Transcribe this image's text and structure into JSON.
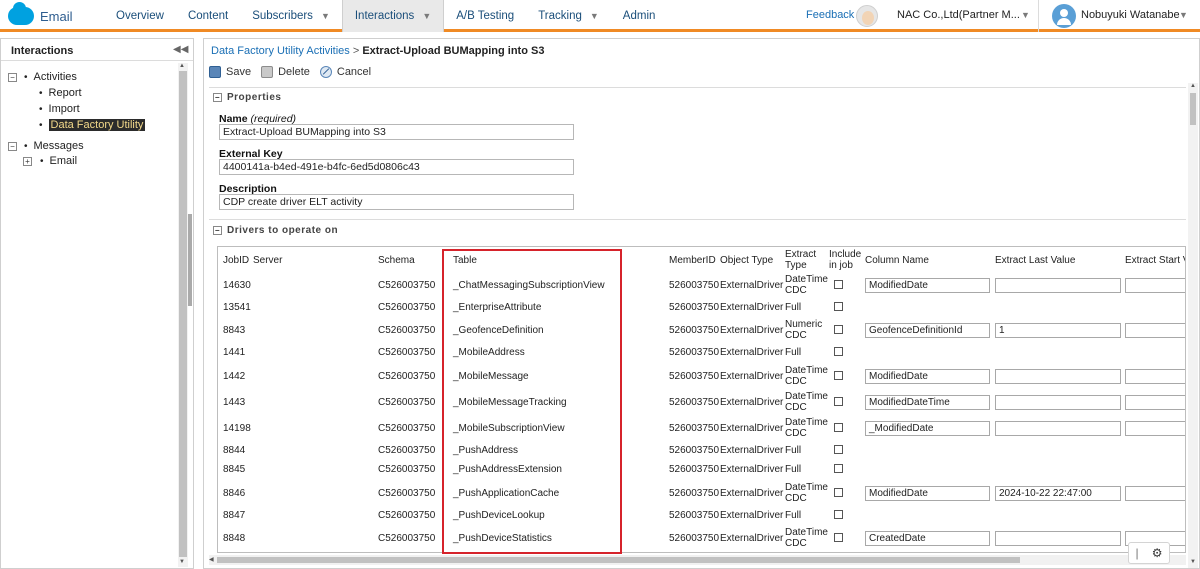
{
  "topnav": {
    "brand": "Email",
    "items": [
      {
        "label": "Overview",
        "caret": false,
        "active": false
      },
      {
        "label": "Content",
        "caret": false,
        "active": false
      },
      {
        "label": "Subscribers",
        "caret": true,
        "active": false
      },
      {
        "label": "Interactions",
        "caret": true,
        "active": true
      },
      {
        "label": "A/B Testing",
        "caret": false,
        "active": false
      },
      {
        "label": "Tracking",
        "caret": true,
        "active": false
      },
      {
        "label": "Admin",
        "caret": false,
        "active": false
      }
    ],
    "feedback": "Feedback",
    "org": "NAC Co.,Ltd(Partner M...",
    "user": "Nobuyuki Watanabe",
    "accent": "#f08a24"
  },
  "sidebar": {
    "title": "Interactions",
    "tree": [
      {
        "label": "Activities",
        "toggle": "−",
        "children": [
          {
            "label": "Report"
          },
          {
            "label": "Import"
          },
          {
            "label": "Data Factory Utility",
            "selected": true
          }
        ]
      },
      {
        "label": "Messages",
        "toggle": "−",
        "children": [
          {
            "label": "Email",
            "toggle": "+"
          }
        ]
      }
    ]
  },
  "main": {
    "breadcrumb_parent": "Data Factory Utility Activities",
    "breadcrumb_sep": " > ",
    "breadcrumb_current": "Extract-Upload BUMapping into S3",
    "toolbar": {
      "save": "Save",
      "delete": "Delete",
      "cancel": "Cancel"
    },
    "properties": {
      "title": "Properties",
      "name_label": "Name",
      "name_hint": "(required)",
      "name_value": "Extract-Upload BUMapping into S3",
      "key_label": "External Key",
      "key_value": "4400141a-b4ed-491e-b4fc-6ed5d0806c43",
      "desc_label": "Description",
      "desc_value": "CDP create driver ELT activity"
    },
    "drivers": {
      "title": "Drivers to operate on",
      "columns": [
        "JobID",
        "Server",
        "Schema",
        "Table",
        "MemberID",
        "Object Type",
        "Extract Type",
        "Include in job",
        "Column Name",
        "Extract Last Value",
        "Extract Start Va"
      ],
      "rows": [
        {
          "jobid": "14630",
          "schema": "C526003750",
          "table": "_ChatMessagingSubscriptionView",
          "member": "526003750",
          "objtype": "ExternalDriver",
          "extract": "DateTime CDC",
          "column": "ModifiedDate",
          "lastval": ""
        },
        {
          "jobid": "13541",
          "schema": "C526003750",
          "table": "_EnterpriseAttribute",
          "member": "526003750",
          "objtype": "ExternalDriver",
          "extract": "Full",
          "column": null,
          "lastval": null
        },
        {
          "jobid": "8843",
          "schema": "C526003750",
          "table": "_GeofenceDefinition",
          "member": "526003750",
          "objtype": "ExternalDriver",
          "extract": "Numeric CDC",
          "column": "GeofenceDefinitionId",
          "lastval": "1"
        },
        {
          "jobid": "1441",
          "schema": "C526003750",
          "table": "_MobileAddress",
          "member": "526003750",
          "objtype": "ExternalDriver",
          "extract": "Full",
          "column": null,
          "lastval": null
        },
        {
          "jobid": "1442",
          "schema": "C526003750",
          "table": "_MobileMessage",
          "member": "526003750",
          "objtype": "ExternalDriver",
          "extract": "DateTime CDC",
          "column": "ModifiedDate",
          "lastval": ""
        },
        {
          "jobid": "1443",
          "schema": "C526003750",
          "table": "_MobileMessageTracking",
          "member": "526003750",
          "objtype": "ExternalDriver",
          "extract": "DateTime CDC",
          "column": "ModifiedDateTime",
          "lastval": ""
        },
        {
          "jobid": "14198",
          "schema": "C526003750",
          "table": "_MobileSubscriptionView",
          "member": "526003750",
          "objtype": "ExternalDriver",
          "extract": "DateTime CDC",
          "column": "_ModifiedDate",
          "lastval": ""
        },
        {
          "jobid": "8844",
          "schema": "C526003750",
          "table": "_PushAddress",
          "member": "526003750",
          "objtype": "ExternalDriver",
          "extract": "Full",
          "column": null,
          "lastval": null
        },
        {
          "jobid": "8845",
          "schema": "C526003750",
          "table": "_PushAddressExtension",
          "member": "526003750",
          "objtype": "ExternalDriver",
          "extract": "Full",
          "column": null,
          "lastval": null
        },
        {
          "jobid": "8846",
          "schema": "C526003750",
          "table": "_PushApplicationCache",
          "member": "526003750",
          "objtype": "ExternalDriver",
          "extract": "DateTime CDC",
          "column": "ModifiedDate",
          "lastval": "2024-10-22 22:47:00"
        },
        {
          "jobid": "8847",
          "schema": "C526003750",
          "table": "_PushDeviceLookup",
          "member": "526003750",
          "objtype": "ExternalDriver",
          "extract": "Full",
          "column": null,
          "lastval": null
        },
        {
          "jobid": "8848",
          "schema": "C526003750",
          "table": "_PushDeviceStatistics",
          "member": "526003750",
          "objtype": "ExternalDriver",
          "extract": "DateTime CDC",
          "column": "CreatedDate",
          "lastval": ""
        }
      ]
    }
  },
  "widget": {
    "icon": "settings-gear-icon"
  }
}
